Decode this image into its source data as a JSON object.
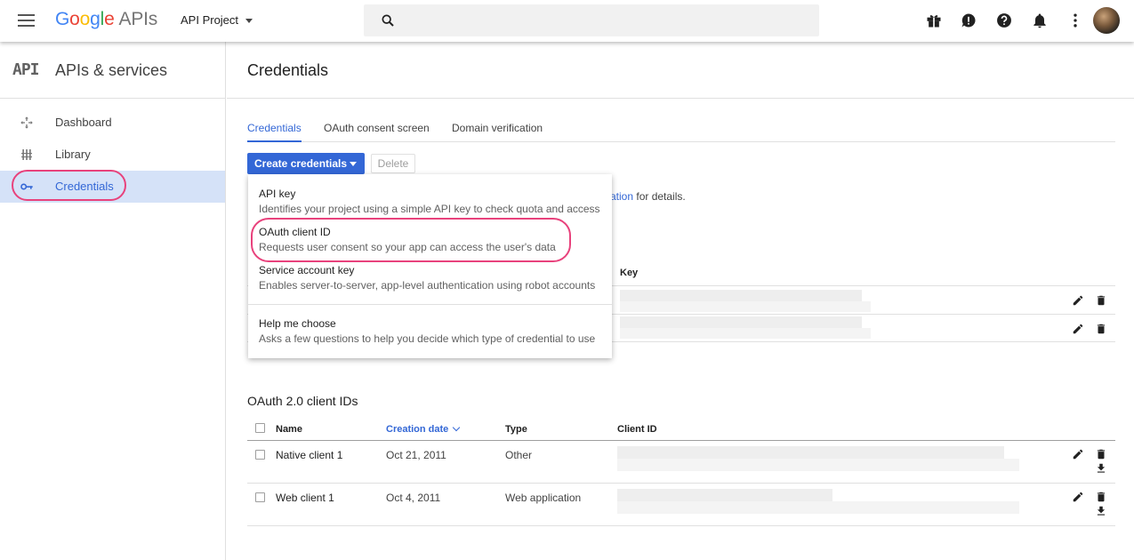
{
  "header": {
    "logo_google": [
      "G",
      "o",
      "o",
      "g",
      "l",
      "e"
    ],
    "logo_apis": "APIs",
    "project": "API Project",
    "icons": [
      "gift-icon",
      "feedback-icon",
      "help-icon",
      "notifications-icon",
      "more-vert-icon"
    ]
  },
  "sidebar": {
    "badge": "API",
    "title": "APIs & services",
    "items": [
      {
        "label": "Dashboard",
        "icon": "dashboard-icon"
      },
      {
        "label": "Library",
        "icon": "library-icon"
      },
      {
        "label": "Credentials",
        "icon": "key-icon",
        "active": true
      }
    ]
  },
  "main": {
    "title": "Credentials",
    "tabs": [
      {
        "label": "Credentials",
        "active": true
      },
      {
        "label": "OAuth consent screen"
      },
      {
        "label": "Domain verification"
      }
    ],
    "create_label": "Create credentials",
    "delete_label": "Delete",
    "info_link": "ation",
    "info_text": " for details.",
    "keys_header": "Key"
  },
  "dropdown": {
    "items": [
      {
        "title": "API key",
        "desc": "Identifies your project using a simple API key to check quota and access"
      },
      {
        "title": "OAuth client ID",
        "desc": "Requests user consent so your app can access the user's data"
      },
      {
        "title": "Service account key",
        "desc": "Enables server-to-server, app-level authentication using robot accounts"
      },
      {
        "title": "Help me choose",
        "desc": "Asks a few questions to help you decide which type of credential to use"
      }
    ]
  },
  "oauth": {
    "title": "OAuth 2.0 client IDs",
    "headers": {
      "name": "Name",
      "date": "Creation date",
      "type": "Type",
      "client_id": "Client ID"
    },
    "rows": [
      {
        "name": "Native client 1",
        "date": "Oct 21, 2011",
        "type": "Other"
      },
      {
        "name": "Web client 1",
        "date": "Oct 4, 2011",
        "type": "Web application"
      }
    ]
  },
  "colors": {
    "accent": "#3367d6",
    "highlight": "#e8427c",
    "active_nav_bg": "#d5e2f8"
  }
}
